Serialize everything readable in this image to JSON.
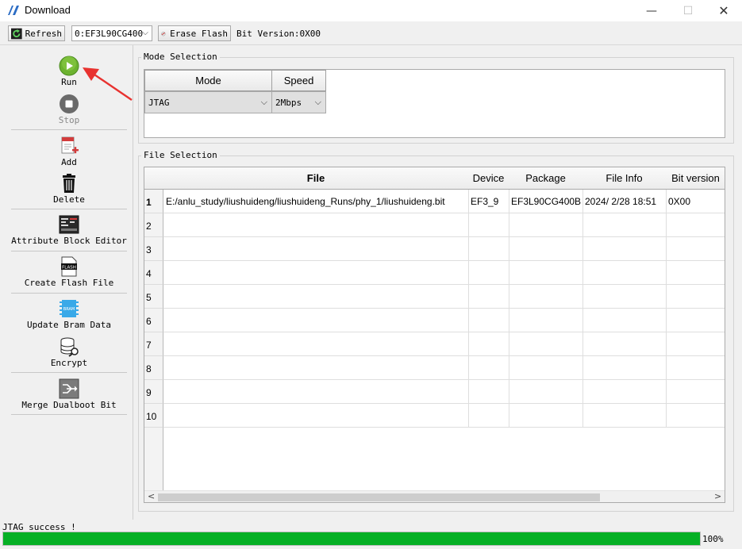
{
  "window": {
    "title": "Download",
    "minimize_glyph": "—",
    "maximize_glyph": "☐",
    "close_glyph": "✕"
  },
  "toolbar": {
    "refresh_label": "Refresh",
    "device_value": "0:EF3L90CG400",
    "erase_flash_label": "Erase Flash",
    "bit_version_text": "Bit Version:0X00"
  },
  "sidebar": {
    "run_label": "Run",
    "stop_label": "Stop",
    "add_label": "Add",
    "delete_label": "Delete",
    "attribute_block_editor_label": "Attribute Block Editor",
    "create_flash_file_label": "Create Flash File",
    "flash_icon_text": "FLASH",
    "update_bram_data_label": "Update Bram Data",
    "bram_icon_text": "BRAM",
    "encrypt_label": "Encrypt",
    "merge_dualboot_bit_label": "Merge Dualboot Bit"
  },
  "mode_selection": {
    "group_title": "Mode Selection",
    "mode_header": "Mode",
    "speed_header": "Speed",
    "mode_value": "JTAG",
    "speed_value": "2Mbps"
  },
  "file_selection": {
    "group_title": "File Selection",
    "columns": [
      "File",
      "Device",
      "Package",
      "File Info",
      "Bit version"
    ],
    "row_numbers": [
      "1",
      "2",
      "3",
      "4",
      "5",
      "6",
      "7",
      "8",
      "9",
      "10"
    ],
    "rows": [
      [
        "E:/anlu_study/liushuideng/liushuideng_Runs/phy_1/liushuideng.bit",
        "EF3_9",
        "EF3L90CG400B",
        "2024/ 2/28 18:51",
        "0X00"
      ],
      [
        "",
        "",
        "",
        "",
        ""
      ],
      [
        "",
        "",
        "",
        "",
        ""
      ],
      [
        "",
        "",
        "",
        "",
        ""
      ],
      [
        "",
        "",
        "",
        "",
        ""
      ],
      [
        "",
        "",
        "",
        "",
        ""
      ],
      [
        "",
        "",
        "",
        "",
        ""
      ],
      [
        "",
        "",
        "",
        "",
        ""
      ],
      [
        "",
        "",
        "",
        "",
        ""
      ],
      [
        "",
        "",
        "",
        "",
        ""
      ]
    ],
    "scroll_left_glyph": "<",
    "scroll_right_glyph": ">"
  },
  "status": {
    "message": "JTAG success !",
    "progress_percent": 100,
    "progress_text": "100%"
  },
  "colors": {
    "progress_fill": "#06b025",
    "annotation_arrow": "#e8322f",
    "run_green": "#5aa025"
  }
}
